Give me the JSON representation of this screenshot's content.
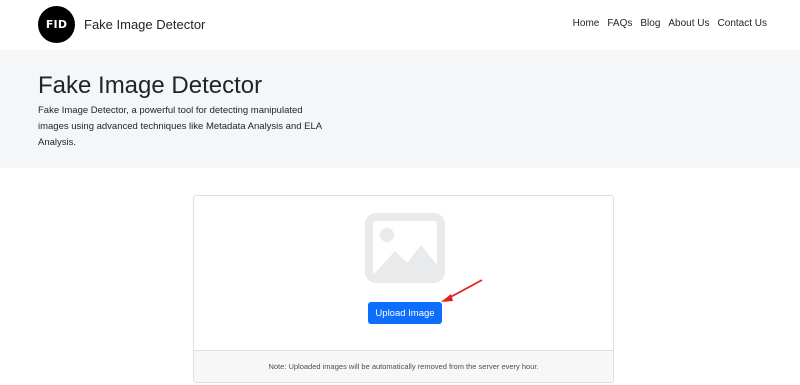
{
  "header": {
    "logo_text": "FID",
    "brand_name": "Fake Image Detector",
    "nav": [
      {
        "label": "Home"
      },
      {
        "label": "FAQs"
      },
      {
        "label": "Blog"
      },
      {
        "label": "About Us"
      },
      {
        "label": "Contact Us"
      }
    ]
  },
  "hero": {
    "title": "Fake Image Detector",
    "description": "Fake Image Detector, a powerful tool for detecting manipulated images using advanced techniques like Metadata Analysis and ELA Analysis."
  },
  "upload": {
    "button_label": "Upload Image",
    "note": "Note: Uploaded images will be automatically removed from the server every hour.",
    "placeholder_icon": "image-placeholder-icon",
    "annotation_icon": "red-arrow-icon"
  },
  "colors": {
    "accent": "#0d6efd",
    "hero_bg": "#f5f6f8",
    "arrow": "#e02020",
    "icon_gray": "#e9eaeb"
  }
}
